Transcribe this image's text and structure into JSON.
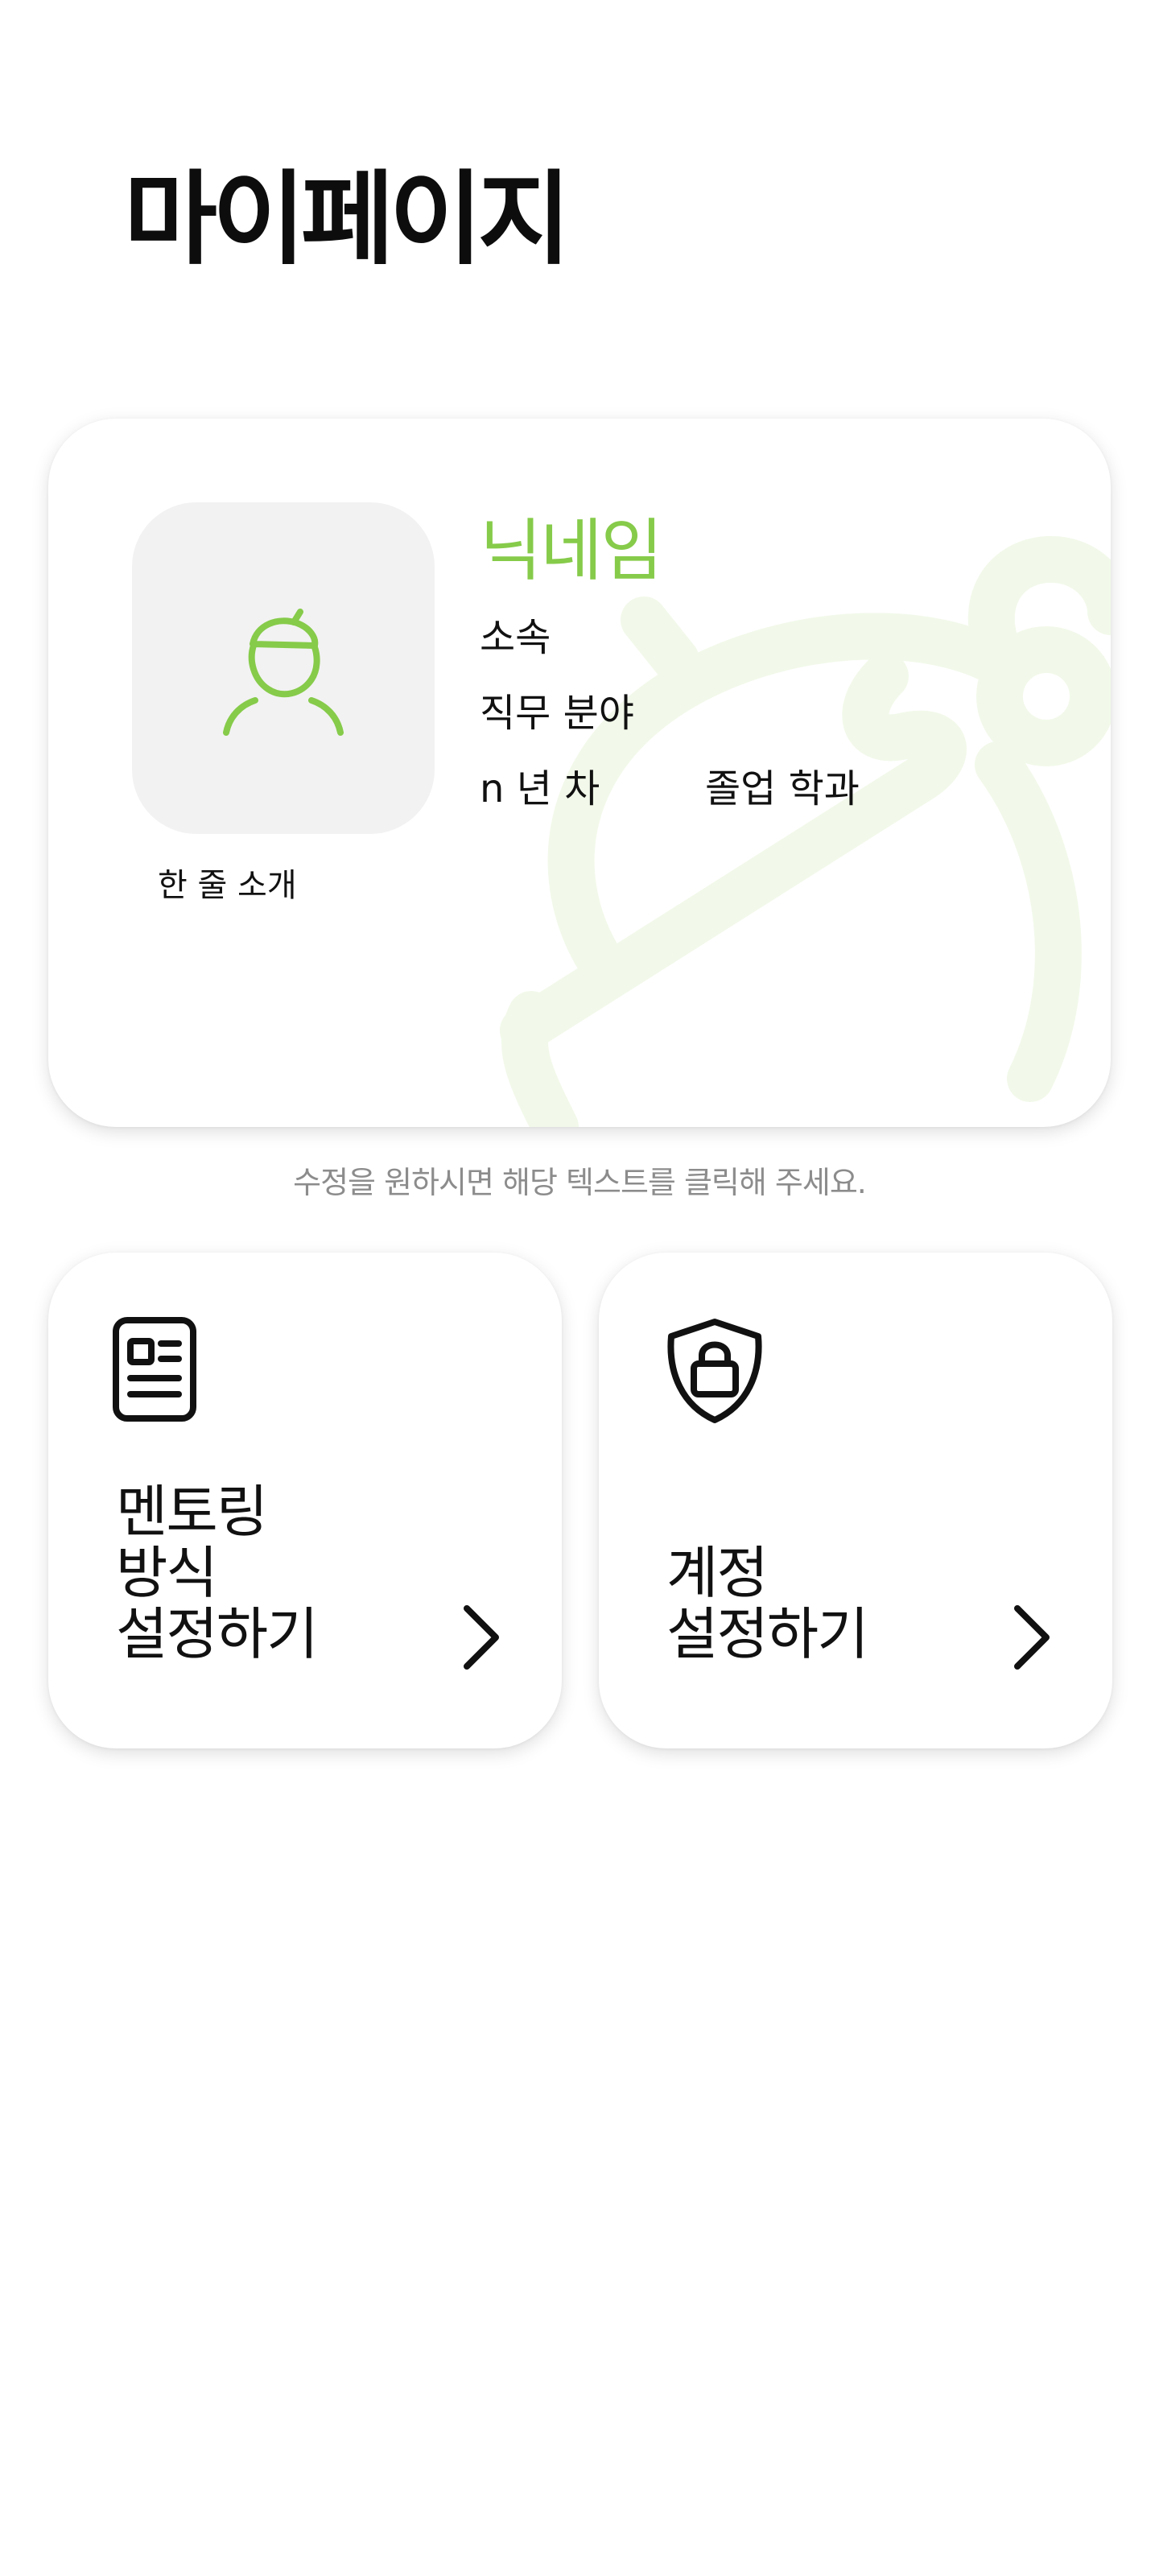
{
  "page": {
    "title": "마이페이지"
  },
  "profile": {
    "nickname": "닉네임",
    "affiliation": "소속",
    "job_field": "직무 분야",
    "years": "n 년 차",
    "major": "졸업 학과",
    "bio": "한 줄 소개",
    "avatar_icon": "user-acorn-icon",
    "accent_color": "#86cb4a"
  },
  "hint": "수정을 원하시면 해당 텍스트를 클릭해 주세요.",
  "menu": [
    {
      "icon": "document-icon",
      "label_lines": [
        "멘토링",
        "방식",
        "설정하기"
      ]
    },
    {
      "icon": "shield-lock-icon",
      "label_lines": [
        "계정",
        "설정하기"
      ]
    }
  ]
}
